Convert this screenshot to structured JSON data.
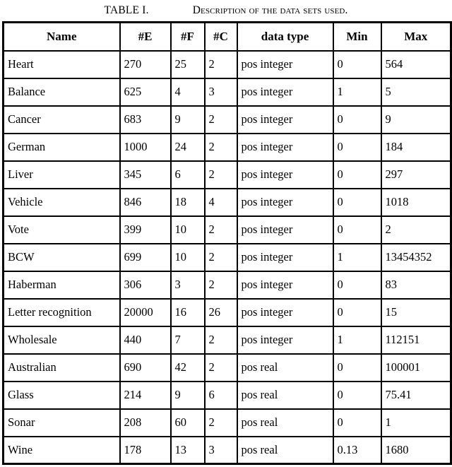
{
  "caption": {
    "label": "TABLE I.",
    "text": "Description of the data sets used."
  },
  "table": {
    "headers": [
      "Name",
      "#E",
      "#F",
      "#C",
      "data type",
      "Min",
      "Max"
    ],
    "rows": [
      {
        "name": "Heart",
        "e": "270",
        "f": "25",
        "c": "2",
        "type": "pos integer",
        "min": "0",
        "max": "564"
      },
      {
        "name": "Balance",
        "e": "625",
        "f": "4",
        "c": "3",
        "type": "pos integer",
        "min": "1",
        "max": "5"
      },
      {
        "name": "Cancer",
        "e": "683",
        "f": "9",
        "c": "2",
        "type": "pos integer",
        "min": "0",
        "max": "9"
      },
      {
        "name": "German",
        "e": "1000",
        "f": "24",
        "c": "2",
        "type": "pos integer",
        "min": "0",
        "max": "184"
      },
      {
        "name": "Liver",
        "e": "345",
        "f": "6",
        "c": "2",
        "type": "pos integer",
        "min": "0",
        "max": "297"
      },
      {
        "name": "Vehicle",
        "e": "846",
        "f": "18",
        "c": "4",
        "type": "pos integer",
        "min": "0",
        "max": "1018"
      },
      {
        "name": "Vote",
        "e": "399",
        "f": "10",
        "c": "2",
        "type": "pos integer",
        "min": "0",
        "max": "2"
      },
      {
        "name": "BCW",
        "e": "699",
        "f": "10",
        "c": "2",
        "type": "pos integer",
        "min": "1",
        "max": "13454352"
      },
      {
        "name": "Haberman",
        "e": "306",
        "f": "3",
        "c": "2",
        "type": "pos integer",
        "min": "0",
        "max": "83"
      },
      {
        "name": "Letter recognition",
        "e": "20000",
        "f": "16",
        "c": "26",
        "type": "pos integer",
        "min": "0",
        "max": "15"
      },
      {
        "name": "Wholesale",
        "e": "440",
        "f": "7",
        "c": "2",
        "type": "pos integer",
        "min": "1",
        "max": "112151"
      },
      {
        "name": "Australian",
        "e": "690",
        "f": "42",
        "c": "2",
        "type": "pos real",
        "min": "0",
        "max": "100001"
      },
      {
        "name": "Glass",
        "e": "214",
        "f": "9",
        "c": "6",
        "type": "pos real",
        "min": "0",
        "max": "75.41"
      },
      {
        "name": "Sonar",
        "e": "208",
        "f": "60",
        "c": "2",
        "type": "pos real",
        "min": "0",
        "max": "1"
      },
      {
        "name": "Wine",
        "e": "178",
        "f": "13",
        "c": "3",
        "type": "pos real",
        "min": "0.13",
        "max": "1680"
      }
    ]
  },
  "colors": {
    "border": "#000000",
    "background": "#ffffff",
    "text": "#000000"
  }
}
